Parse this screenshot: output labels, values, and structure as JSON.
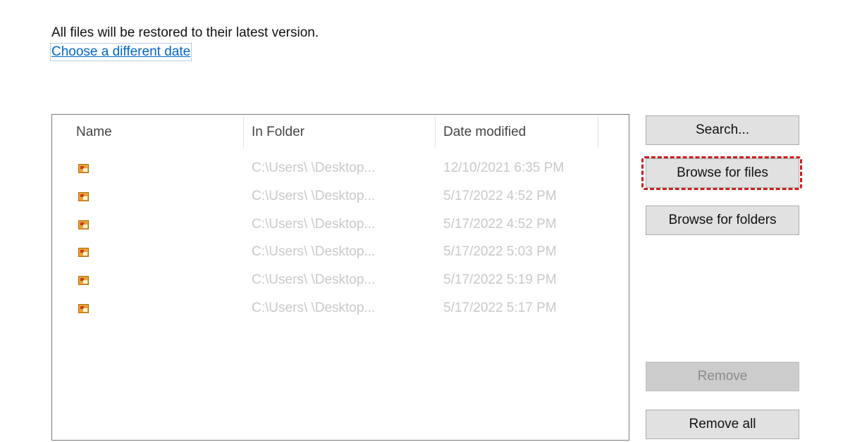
{
  "header": {
    "info_text": "All files will be restored to their latest version.",
    "date_link": "Choose a different date"
  },
  "list": {
    "columns": [
      "Name",
      "In Folder",
      "Date modified"
    ],
    "rows": [
      {
        "name": "",
        "folder": "C:\\Users\\     \\Desktop...",
        "date": "12/10/2021 6:35 PM",
        "icon": "image-file-icon"
      },
      {
        "name": "",
        "folder": "C:\\Users\\     \\Desktop...",
        "date": "5/17/2022 4:52 PM",
        "icon": "image-file-icon"
      },
      {
        "name": "",
        "folder": "C:\\Users\\     \\Desktop...",
        "date": "5/17/2022 4:52 PM",
        "icon": "image-file-icon"
      },
      {
        "name": "",
        "folder": "C:\\Users\\     \\Desktop...",
        "date": "5/17/2022 5:03 PM",
        "icon": "image-file-icon"
      },
      {
        "name": "",
        "folder": "C:\\Users\\     \\Desktop...",
        "date": "5/17/2022 5:19 PM",
        "icon": "image-file-icon"
      },
      {
        "name": "",
        "folder": "C:\\Users\\     \\Desktop...",
        "date": "5/17/2022 5:17 PM",
        "icon": "image-file-icon"
      }
    ]
  },
  "buttons": {
    "search": "Search...",
    "browse_files": "Browse for files",
    "browse_folders": "Browse for folders",
    "remove": "Remove",
    "remove_all": "Remove all"
  },
  "colors": {
    "link": "#0066cc",
    "highlight": "#cc1f1f",
    "button_bg": "#e1e1e1",
    "disabled_button_bg": "#cccccc"
  }
}
